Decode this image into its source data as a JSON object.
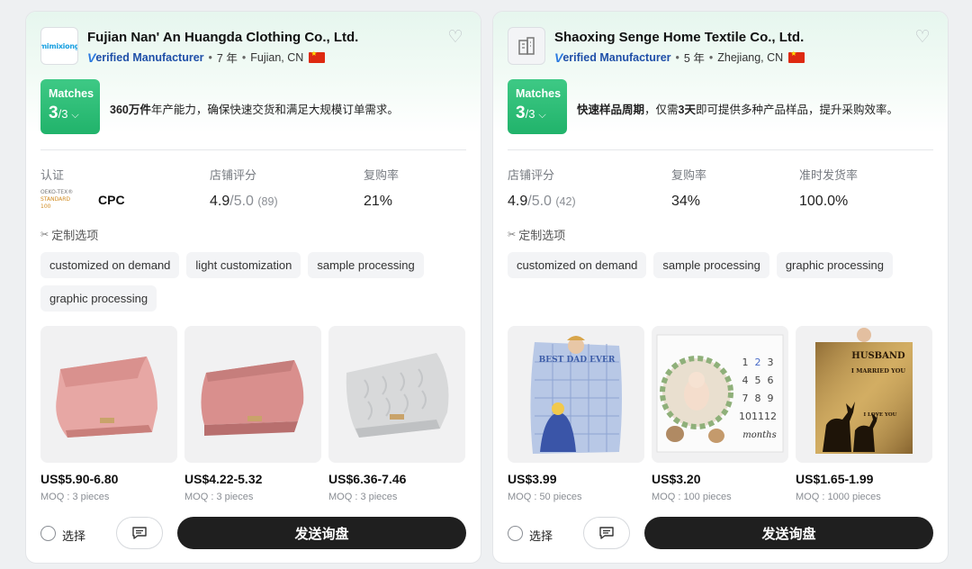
{
  "colors": {
    "accent_green": "#2bbd77",
    "verified_blue": "#1f4fa8",
    "dark_button": "#1f1f1f"
  },
  "suppliers": [
    {
      "name": "Fujian Nan' An Huangda Clothing Co., Ltd.",
      "logo_text": "mimixiong",
      "verified": "erified Manufacturer",
      "verified_v": "V",
      "years": "7 年",
      "location": "Fujian, CN",
      "matches_label": "Matches",
      "matches_value": "3",
      "matches_total": "/3",
      "highlight_bold": "360万件",
      "highlight_rest": "年产能力，确保快速交货和满足大规模订单需求。",
      "stats": [
        {
          "label": "认证",
          "value": ""
        },
        {
          "label": "店铺评分",
          "value": "4.9",
          "sub": "/5.0",
          "count": "(89)"
        },
        {
          "label": "复购率",
          "value": "21%"
        }
      ],
      "cert_logo_line1": "OEKO-TEX®",
      "cert_logo_line2": "STANDARD 100",
      "cert_label": "CPC",
      "custom_title": "定制选项",
      "tags": [
        "customized on demand",
        "light customization",
        "sample processing",
        "graphic processing"
      ],
      "products": [
        {
          "price": "US$5.90-6.80",
          "moq": "MOQ : 3 pieces",
          "image": "pink-knit-blanket"
        },
        {
          "price": "US$4.22-5.32",
          "moq": "MOQ : 3 pieces",
          "image": "rose-knit-blanket"
        },
        {
          "price": "US$6.36-7.46",
          "moq": "MOQ : 3 pieces",
          "image": "gray-knit-blanket"
        }
      ],
      "select_label": "选择",
      "inquiry_label": "发送询盘"
    },
    {
      "name": "Shaoxing Senge Home Textile Co., Ltd.",
      "logo_text": "",
      "verified": "erified Manufacturer",
      "verified_v": "V",
      "years": "5 年",
      "location": "Zhejiang, CN",
      "matches_label": "Matches",
      "matches_value": "3",
      "matches_total": "/3",
      "highlight_bold": "快速样品周期",
      "highlight_mid": "，仅需",
      "highlight_bold2": "3天",
      "highlight_rest": "即可提供多种产品样品，提升采购效率。",
      "stats": [
        {
          "label": "店铺评分",
          "value": "4.9",
          "sub": "/5.0",
          "count": "(42)"
        },
        {
          "label": "复购率",
          "value": "34%"
        },
        {
          "label": "准时发货率",
          "value": "100.0%"
        }
      ],
      "custom_title": "定制选项",
      "tags": [
        "customized on demand",
        "sample processing",
        "graphic processing"
      ],
      "products": [
        {
          "price": "US$3.99",
          "moq": "MOQ : 50 pieces",
          "image": "best-dad-ever-blanket",
          "img_text": "BEST DAD EVER"
        },
        {
          "price": "US$3.20",
          "moq": "MOQ : 100 pieces",
          "image": "baby-milestone-blanket",
          "img_text": "months",
          "img_digits": [
            "1",
            "2",
            "3",
            "4",
            "5",
            "6",
            "7",
            "8",
            "9",
            "10",
            "11",
            "12"
          ]
        },
        {
          "price": "US$1.65-1.99",
          "moq": "MOQ : 1000 pieces",
          "image": "husband-deer-blanket",
          "img_text": "HUSBAND",
          "img_text2": "I MARRIED YOU",
          "img_text3": "I LOVE YOU"
        }
      ],
      "select_label": "选择",
      "inquiry_label": "发送询盘"
    }
  ]
}
